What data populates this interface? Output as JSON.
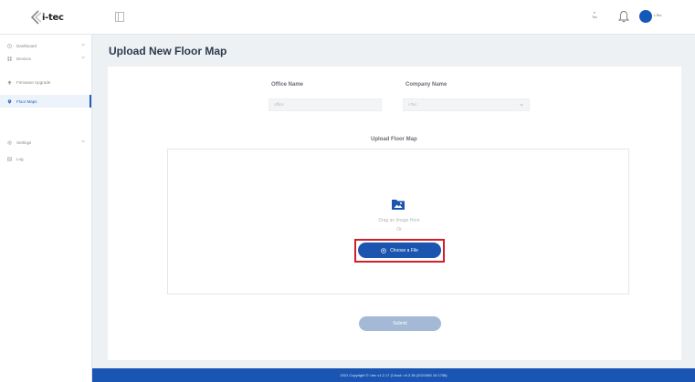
{
  "header": {
    "logo_text": "i-tec",
    "lang_lines": [
      "ᴇ",
      "Tec"
    ],
    "user_name": "i-Tec"
  },
  "sidebar": {
    "items": [
      {
        "label": "Dashboard",
        "icon": "clock-icon",
        "has_caret": true
      },
      {
        "label": "Devices",
        "icon": "grid-icon",
        "has_caret": true
      },
      {
        "label": "Firmware Upgrade",
        "icon": "upgrade-icon",
        "has_caret": false
      },
      {
        "label": "Floor Maps",
        "icon": "map-pin-icon",
        "has_caret": false,
        "active": true
      },
      {
        "label": "Settings",
        "icon": "gear-icon",
        "has_caret": true
      },
      {
        "label": "Log",
        "icon": "log-icon",
        "has_caret": false
      }
    ]
  },
  "page": {
    "title": "Upload New Floor Map"
  },
  "form": {
    "office_label": "Office Name",
    "office_placeholder": "office",
    "company_label": "Company Name",
    "company_value": "i-Tec",
    "upload_label": "Upload Floor Map",
    "drag_text": "Drag an Image Here",
    "or_text": "Or",
    "choose_label": "Choose a File",
    "submit_label": "Submit"
  },
  "footer": {
    "text": "2021 Copyright © i-tec  v1.2.17 (Cloud: v4.3.36 (2021080 10:1758)"
  },
  "colors": {
    "brand_blue": "#1b55b0",
    "highlight_red": "#d01f2a",
    "submit_disabled": "#a3b9d6"
  }
}
